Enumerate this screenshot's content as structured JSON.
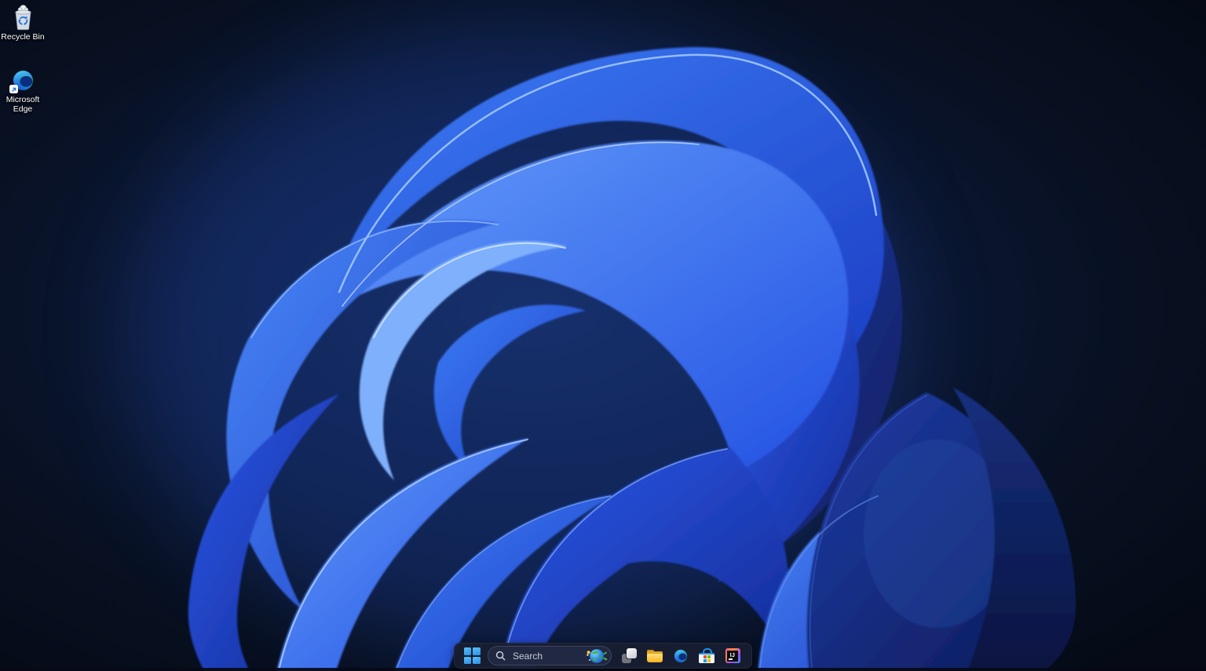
{
  "desktop": {
    "icons": [
      {
        "label": "Recycle Bin",
        "icon": "recycle-bin-icon"
      },
      {
        "label": "Microsoft Edge",
        "icon": "microsoft-edge-icon",
        "has_shortcut_arrow": true
      }
    ]
  },
  "taskbar": {
    "start_icon": "windows-logo-icon",
    "search": {
      "placeholder": "Search",
      "left_icon": "magnifier-icon",
      "right_icon": "bing-daily-globe-icon"
    },
    "apps": [
      {
        "icon": "task-view-icon"
      },
      {
        "icon": "file-explorer-folder-icon"
      },
      {
        "icon": "microsoft-edge-icon"
      },
      {
        "icon": "microsoft-store-bag-icon"
      },
      {
        "icon": "intellij-idea-icon",
        "monogram": "IJ"
      }
    ]
  },
  "colors": {
    "background_navy": "#081226",
    "bloom_blue": "#2e63f2",
    "bloom_highlight": "#a9cdff",
    "taskbar_background": "#181e31",
    "search_pill_background": "#212842",
    "windows_logo_blue": "#3ea6f2",
    "folder_yellow": "#f6b82e",
    "store_handle_blue": "#1e8ee8",
    "microsoft_logo_colors": [
      "#f25022",
      "#7fba00",
      "#00a4ef",
      "#ffb900"
    ],
    "icon_label_text": "#ffffff"
  }
}
